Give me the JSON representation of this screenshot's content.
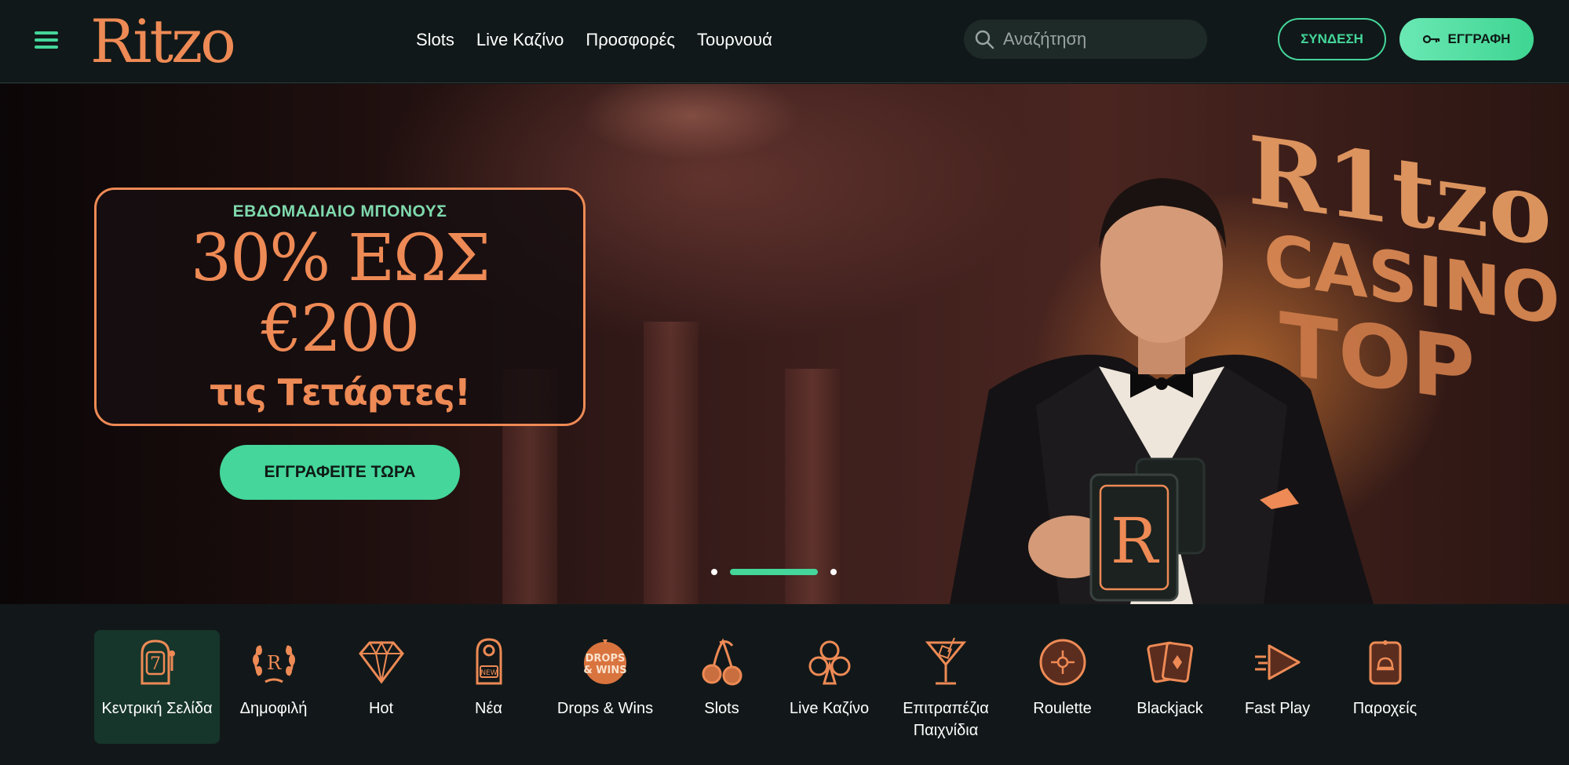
{
  "header": {
    "logo": "Ritzo",
    "nav": [
      "Slots",
      "Live Καζίνο",
      "Προσφορές",
      "Τουρνουά"
    ],
    "search_placeholder": "Αναζήτηση",
    "login_label": "ΣΥΝΔΕΣΗ",
    "register_label": "ΕΓΓΡΑΦΗ"
  },
  "hero": {
    "kicker": "ΕΒΔΟΜΑΔΙΑΙΟ ΜΠΟΝΟΥΣ",
    "headline_line1": "30% ΕΩΣ",
    "headline_line2": "€200",
    "subline": "τις Τετάρτες!",
    "cta_label": "ΕΓΓΡΑΦΕΙΤΕ ΤΩΡΑ",
    "card_letter": "R",
    "wall_line1": "R1tzo",
    "wall_line2": "CASINO",
    "wall_line3": "TOP",
    "slides": 3,
    "active_slide": 2
  },
  "categories": [
    {
      "label": "Κεντρική Σελίδα",
      "icon": "slot-machine-icon",
      "active": true
    },
    {
      "label": "Δημοφιλή",
      "icon": "laurel-r-icon",
      "active": false
    },
    {
      "label": "Hot",
      "icon": "diamond-icon",
      "active": false
    },
    {
      "label": "Νέα",
      "icon": "door-hanger-new-icon",
      "active": false
    },
    {
      "label": "Drops & Wins",
      "icon": "drops-wins-icon",
      "active": false
    },
    {
      "label": "Slots",
      "icon": "cherries-icon",
      "active": false
    },
    {
      "label": "Live Καζίνο",
      "icon": "club-icon",
      "active": false
    },
    {
      "label": "Επιτραπέζια Παιχνίδια",
      "icon": "cocktail-icon",
      "active": false
    },
    {
      "label": "Roulette",
      "icon": "roulette-icon",
      "active": false
    },
    {
      "label": "Blackjack",
      "icon": "cards-icon",
      "active": false
    },
    {
      "label": "Fast Play",
      "icon": "fast-play-icon",
      "active": false
    },
    {
      "label": "Παροχείς",
      "icon": "provider-icon",
      "active": false
    }
  ],
  "drops_icon_text": {
    "top": "DROPS",
    "bottom": "& WINS"
  },
  "new_icon_text": "NEW",
  "colors": {
    "accent": "#44d69a",
    "brand": "#ee8a55",
    "bg": "#111819"
  }
}
